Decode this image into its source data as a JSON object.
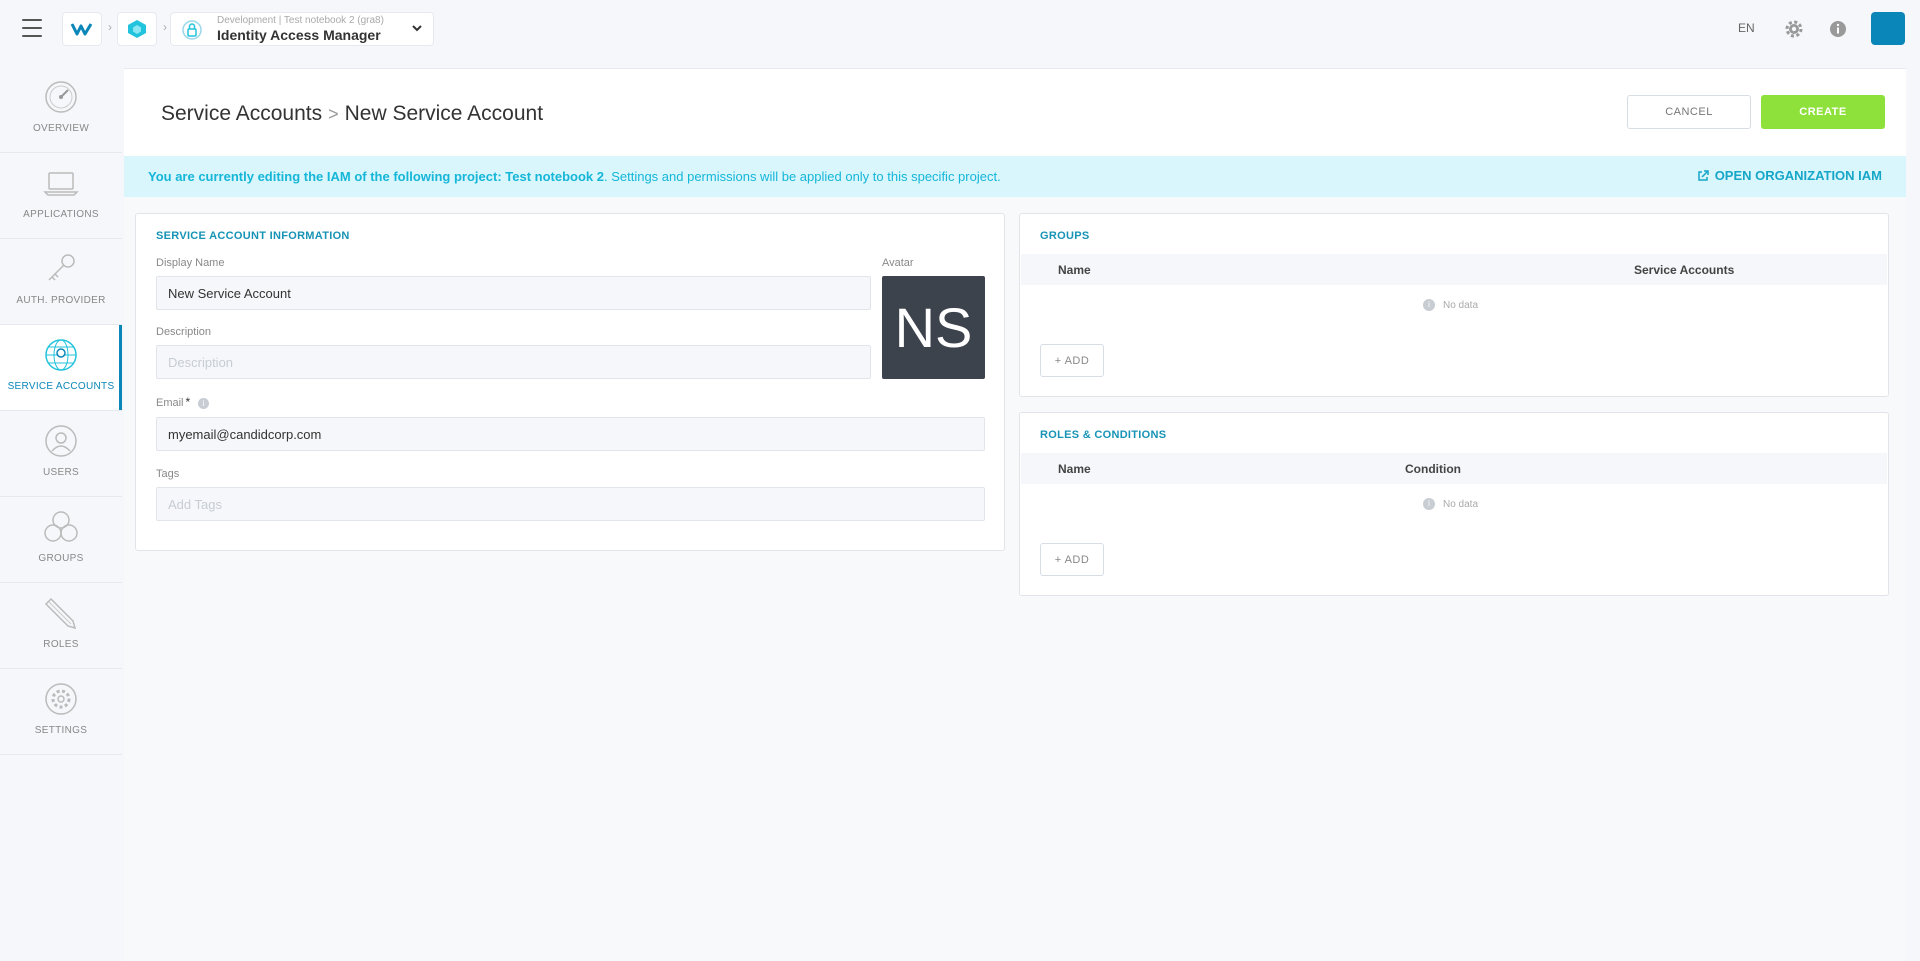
{
  "topbar": {
    "project_sub": "Development | Test notebook 2 (gra8)",
    "project_title": "Identity Access Manager",
    "language": "EN",
    "icons": [
      "menu-icon",
      "logo-icon",
      "workspace-icon",
      "lock-hand-icon",
      "chevron-down-icon",
      "gear-icon",
      "info-icon"
    ]
  },
  "sidebar": {
    "items": [
      {
        "label": "OVERVIEW",
        "icon": "gauge-icon"
      },
      {
        "label": "APPLICATIONS",
        "icon": "laptop-icon"
      },
      {
        "label": "AUTH. PROVIDER",
        "icon": "key-icon"
      },
      {
        "label": "SERVICE ACCOUNTS",
        "icon": "globe-user-icon",
        "active": true
      },
      {
        "label": "USERS",
        "icon": "user-icon"
      },
      {
        "label": "GROUPS",
        "icon": "group-icon"
      },
      {
        "label": "ROLES",
        "icon": "pencil-icon"
      },
      {
        "label": "SETTINGS",
        "icon": "gear-icon"
      }
    ]
  },
  "header": {
    "breadcrumb_parent": "Service Accounts",
    "breadcrumb_separator": ">",
    "breadcrumb_current": "New Service Account",
    "cancel_label": "CANCEL",
    "create_label": "CREATE"
  },
  "banner": {
    "bold_text": "You are currently editing the IAM of the following project: Test notebook 2",
    "rest_text": ". Settings and permissions will be applied only to this specific project.",
    "link_label": "OPEN ORGANIZATION IAM"
  },
  "info_card": {
    "title": "SERVICE ACCOUNT INFORMATION",
    "display_name_label": "Display Name",
    "display_name_value": "New Service Account",
    "avatar_label": "Avatar",
    "avatar_initials": "NS",
    "description_label": "Description",
    "description_placeholder": "Description",
    "email_label": "Email",
    "email_required": "*",
    "email_value": "myemail@candidcorp.com",
    "tags_label": "Tags",
    "tags_placeholder": "Add Tags"
  },
  "groups_card": {
    "title": "GROUPS",
    "col_name": "Name",
    "col_service_accounts": "Service Accounts",
    "no_data": "No data",
    "add_label": "ADD"
  },
  "roles_card": {
    "title": "ROLES & CONDITIONS",
    "col_name": "Name",
    "col_condition": "Condition",
    "no_data": "No data",
    "add_label": "ADD"
  },
  "colors": {
    "accent": "#0b86b8",
    "create": "#8ee03b",
    "banner_bg": "#d8f6fc",
    "banner_text": "#16b6d8"
  }
}
